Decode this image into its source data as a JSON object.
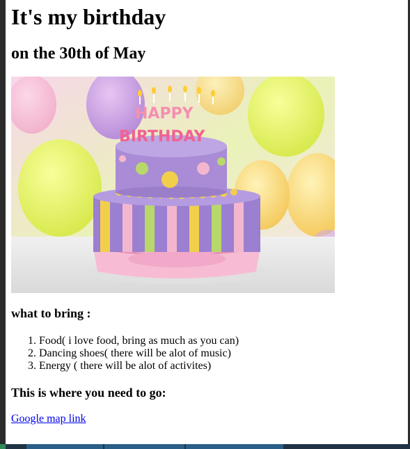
{
  "page": {
    "title": "It's my birthday",
    "subtitle": "on the 30th of May"
  },
  "image": {
    "alt": "Birthday cake with candles",
    "candle_text": [
      "HAPPY",
      "BIRTHDAY"
    ]
  },
  "bring": {
    "heading": "what to bring :",
    "items": [
      "Food( i love food, bring as much as you can)",
      "Dancing shoes( there will be alot of music)",
      "Energy ( there will be alot of activites)"
    ]
  },
  "location": {
    "heading": "This is where you need to go:",
    "link_label": "Google map link"
  },
  "colors": {
    "link": "#0000ee",
    "cake_purple": "#9b7fd0",
    "cake_pink": "#f4b6cf",
    "cake_yellow": "#f2cf4a",
    "cake_green": "#b8d86a"
  }
}
